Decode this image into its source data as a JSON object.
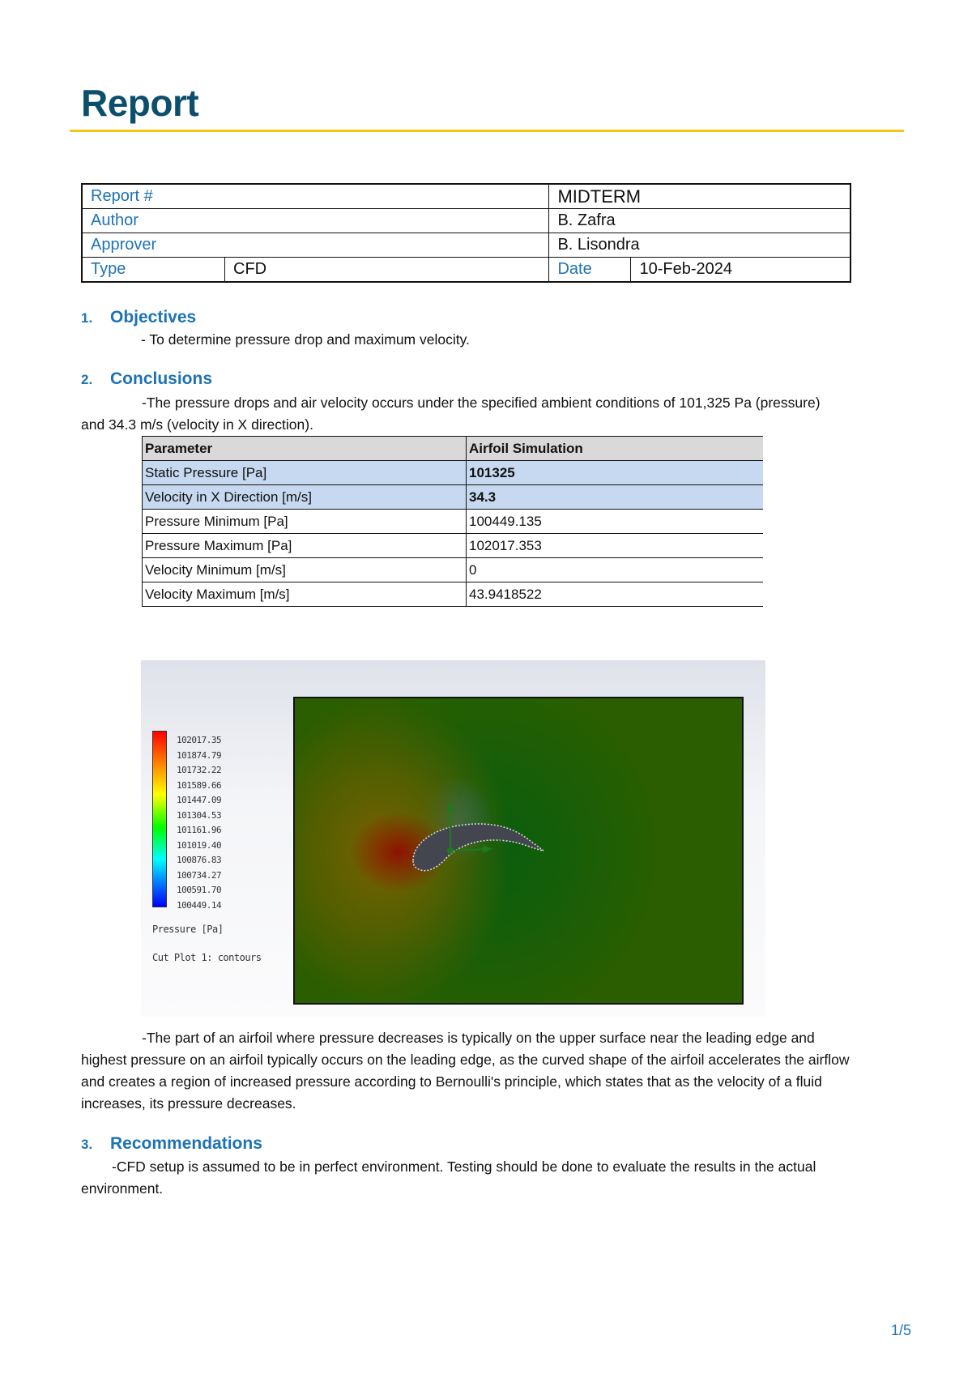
{
  "title": "Report",
  "info": {
    "report_no_label": "Report #",
    "report_no": "MIDTERM",
    "author_label": "Author",
    "author": "B. Zafra",
    "approver_label": "Approver",
    "approver": "B. Lisondra",
    "type_label": "Type",
    "type": "CFD",
    "date_label": "Date",
    "date": "10-Feb-2024"
  },
  "sections": [
    {
      "num": "1.",
      "title": "Objectives",
      "text": "- To determine pressure drop and maximum velocity."
    },
    {
      "num": "2.",
      "title": "Conclusions",
      "text": "-The pressure drops and air velocity occurs under the specified ambient conditions of 101,325 Pa (pressure) and 34.3 m/s (velocity in X direction)."
    },
    {
      "num": "3.",
      "title": "Recommendations",
      "text": "-CFD setup is assumed to be in perfect environment. Testing should be done to evaluate the results in the actual environment."
    }
  ],
  "params": {
    "headers": [
      "Parameter",
      "Airfoil Simulation"
    ],
    "rows": [
      [
        "Static Pressure [Pa]",
        "101325"
      ],
      [
        "Velocity in X Direction [m/s]",
        "34.3"
      ],
      [
        "Pressure Minimum [Pa]",
        "100449.135"
      ],
      [
        "Pressure Maximum [Pa]",
        "102017.353"
      ],
      [
        "Velocity Minimum [m/s]",
        "0"
      ],
      [
        "Velocity Maximum [m/s]",
        "43.9418522"
      ]
    ]
  },
  "figure": {
    "legend_values": [
      "102017.35",
      "101874.79",
      "101732.22",
      "101589.66",
      "101447.09",
      "101304.53",
      "101161.96",
      "101019.40",
      "100876.83",
      "100734.27",
      "100591.70",
      "100449.14"
    ],
    "legend_title": "Pressure [Pa]",
    "legend_subtitle": "Cut Plot 1: contours",
    "axis_x": "X",
    "axis_y": "Y",
    "axis_z": "Z"
  },
  "discussion": "-The part of an airfoil where pressure decreases is typically on the upper surface near the leading edge and highest pressure on an airfoil typically occurs on the leading edge, as the curved shape of the airfoil accelerates the airflow and creates a region of increased pressure according to Bernoulli's principle, which states that as the velocity of a fluid increases, its pressure decreases.",
  "page_number": "1/5"
}
